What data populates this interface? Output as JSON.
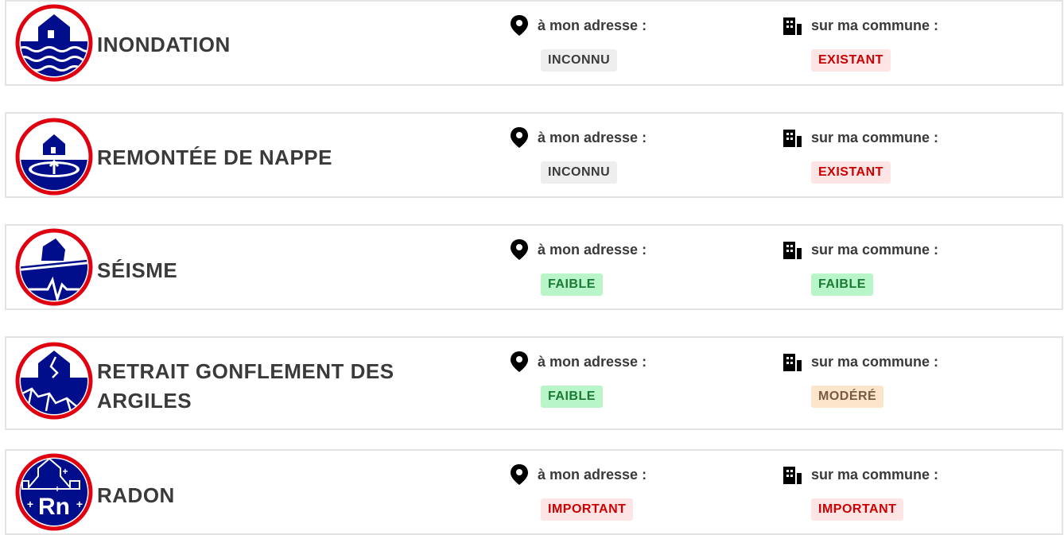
{
  "labels": {
    "address": "à mon adresse :",
    "commune": "sur ma commune :"
  },
  "colors": {
    "icon_blue": "#000e8c",
    "icon_ring": "#e1000f",
    "badge_grey": "#eeeeee",
    "badge_red": "#fde5e5",
    "badge_green": "#b8f5c8",
    "badge_orange": "#fde5cc"
  },
  "risks": [
    {
      "id": "inondation",
      "icon": "flood-icon",
      "title": "INONDATION",
      "address_status": "INCONNU",
      "address_level": "grey",
      "commune_status": "EXISTANT",
      "commune_level": "red"
    },
    {
      "id": "remontee-nappe",
      "icon": "groundwater-rise-icon",
      "title": "REMONTÉE DE NAPPE",
      "address_status": "INCONNU",
      "address_level": "grey",
      "commune_status": "EXISTANT",
      "commune_level": "red"
    },
    {
      "id": "seisme",
      "icon": "earthquake-icon",
      "title": "SÉISME",
      "address_status": "FAIBLE",
      "address_level": "green",
      "commune_status": "FAIBLE",
      "commune_level": "green"
    },
    {
      "id": "argiles",
      "icon": "clay-shrink-swell-icon",
      "title": "RETRAIT GONFLEMENT DES ARGILES",
      "address_status": "FAIBLE",
      "address_level": "green",
      "commune_status": "MODÉRÉ",
      "commune_level": "orange"
    },
    {
      "id": "radon",
      "icon": "radon-icon",
      "title": "RADON",
      "address_status": "IMPORTANT",
      "address_level": "red",
      "commune_status": "IMPORTANT",
      "commune_level": "red"
    }
  ]
}
